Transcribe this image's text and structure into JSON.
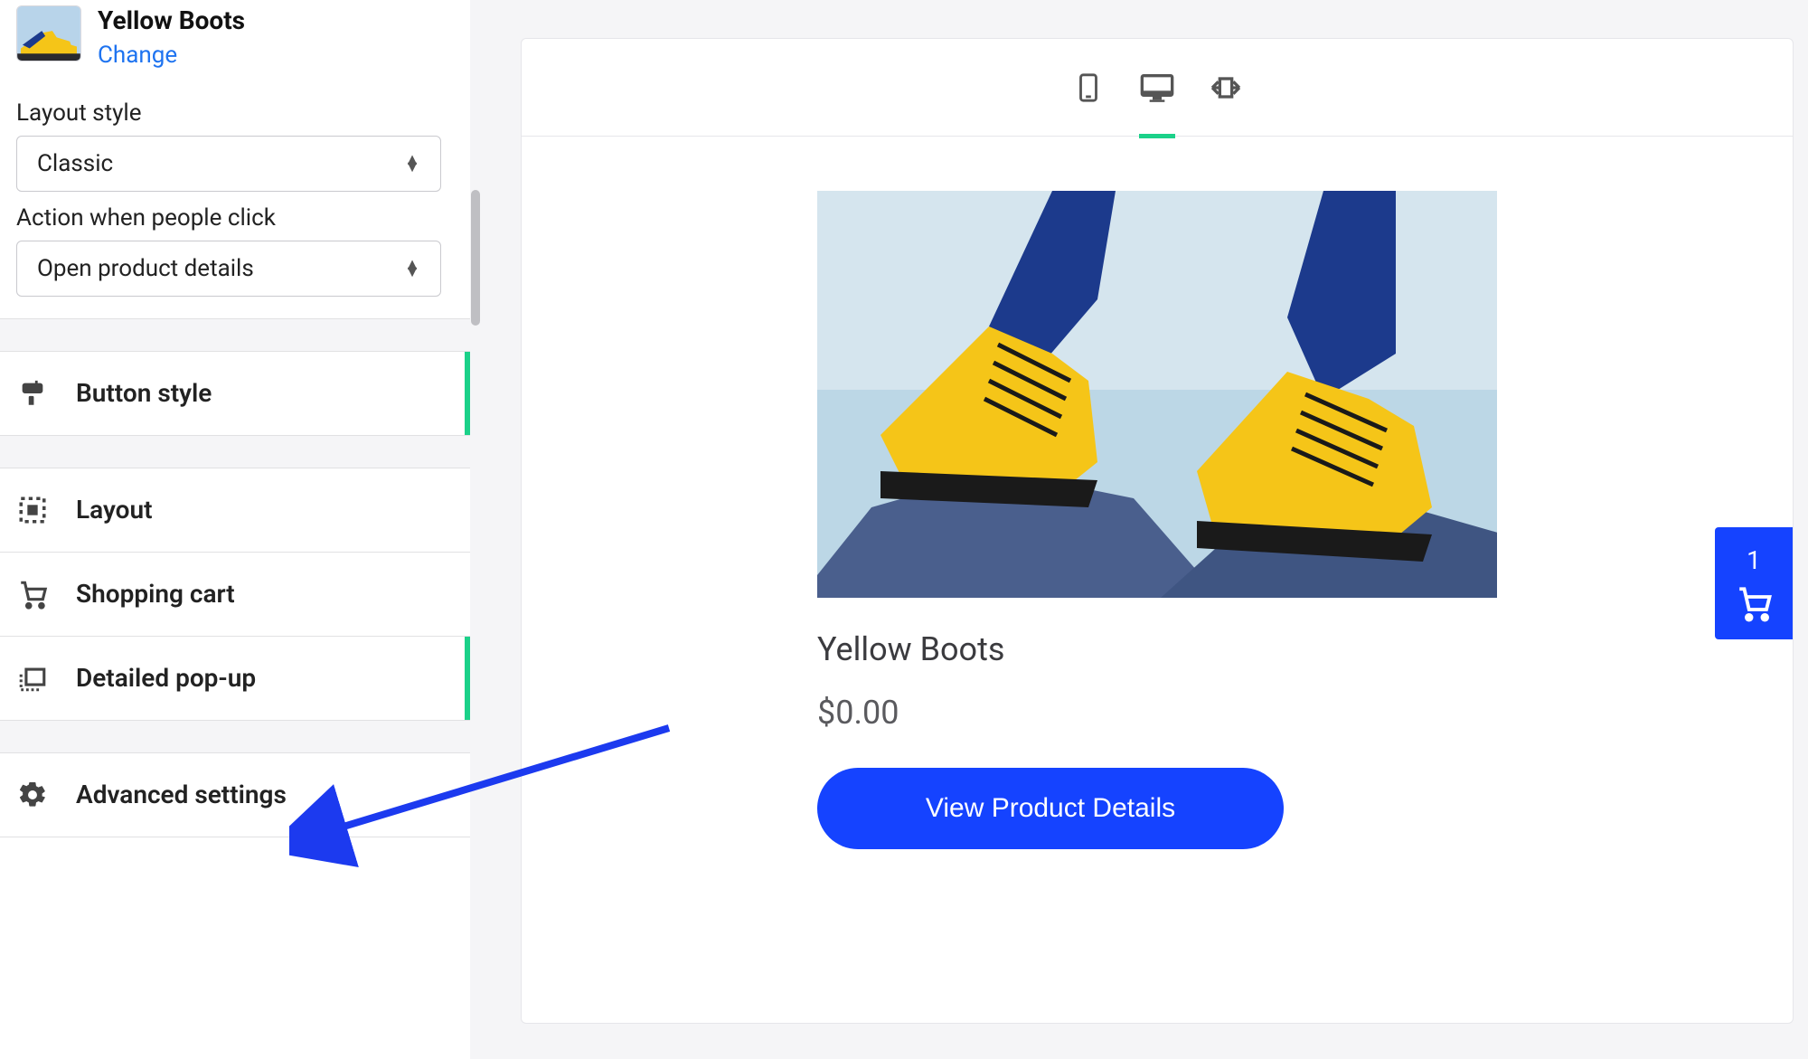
{
  "sidebar": {
    "product_name": "Yellow Boots",
    "change_link": "Change",
    "layout_style_label": "Layout style",
    "layout_style_value": "Classic",
    "action_click_label": "Action when people click",
    "action_click_value": "Open product details",
    "nav": {
      "button_style": "Button style",
      "layout": "Layout",
      "shopping_cart": "Shopping cart",
      "detailed_popup": "Detailed pop-up",
      "advanced_settings": "Advanced settings"
    }
  },
  "preview": {
    "product_title": "Yellow Boots",
    "product_price": "$0.00",
    "cta_label": "View Product Details",
    "cart_count": "1"
  }
}
